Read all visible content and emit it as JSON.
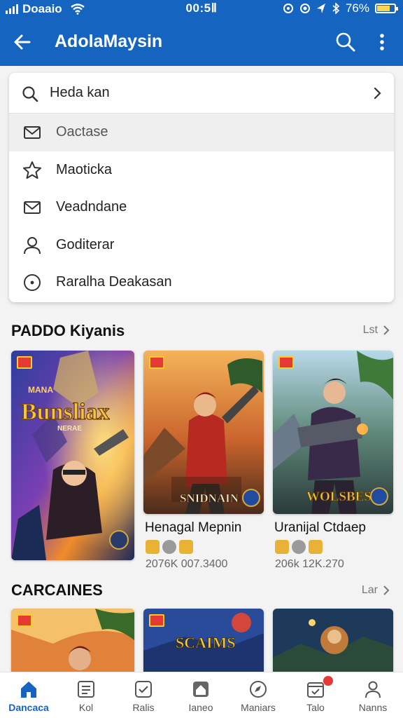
{
  "status_bar": {
    "carrier": "Doaaio",
    "time": "00:5Ⅱ",
    "battery": "76%",
    "battery_level": 0.76
  },
  "app_bar": {
    "title": "AdolaMaysin"
  },
  "search": {
    "value": "Heda kan"
  },
  "menu": {
    "items": [
      {
        "label": "Oactase",
        "icon": "mail-icon"
      },
      {
        "label": "Maoticka",
        "icon": "star-icon"
      },
      {
        "label": "Veadndane",
        "icon": "mail-icon"
      },
      {
        "label": "Goditerar",
        "icon": "person-icon"
      },
      {
        "label": "Raralha Deakasan",
        "icon": "compass-icon"
      }
    ]
  },
  "section1": {
    "title": "PADDO Kiyanis",
    "see_all": "Lst",
    "cards": [
      {
        "art_title": "Bunsliax",
        "art_subtitle": "NERAE",
        "art_top": "MANA"
      },
      {
        "art_title": "SNIDNAIN",
        "title": "Henagal Mepnin",
        "meta": "2076K 007.3400"
      },
      {
        "art_title": "WOLSBES",
        "title": "Uranijal Ctdaep",
        "meta": "206k 12K.270"
      }
    ]
  },
  "section2": {
    "title": "CARCAINES",
    "see_all": "Lar",
    "cards": [
      {
        "art_title": ""
      },
      {
        "art_title": "SCAIMS"
      },
      {
        "art_title": ""
      }
    ]
  },
  "bottom_nav": {
    "items": [
      {
        "label": "Dancaca",
        "icon": "home-icon",
        "active": true
      },
      {
        "label": "Kol",
        "icon": "list-icon"
      },
      {
        "label": "Ralis",
        "icon": "check-card-icon"
      },
      {
        "label": "Ianeo",
        "icon": "house-icon"
      },
      {
        "label": "Maniars",
        "icon": "compass-icon"
      },
      {
        "label": "Talo",
        "icon": "calendar-check-icon",
        "badge": true
      },
      {
        "label": "Nanns",
        "icon": "person-icon"
      }
    ]
  },
  "colors": {
    "primary": "#1565c0",
    "accent_red": "#e53935",
    "gold": "#ffca28"
  }
}
